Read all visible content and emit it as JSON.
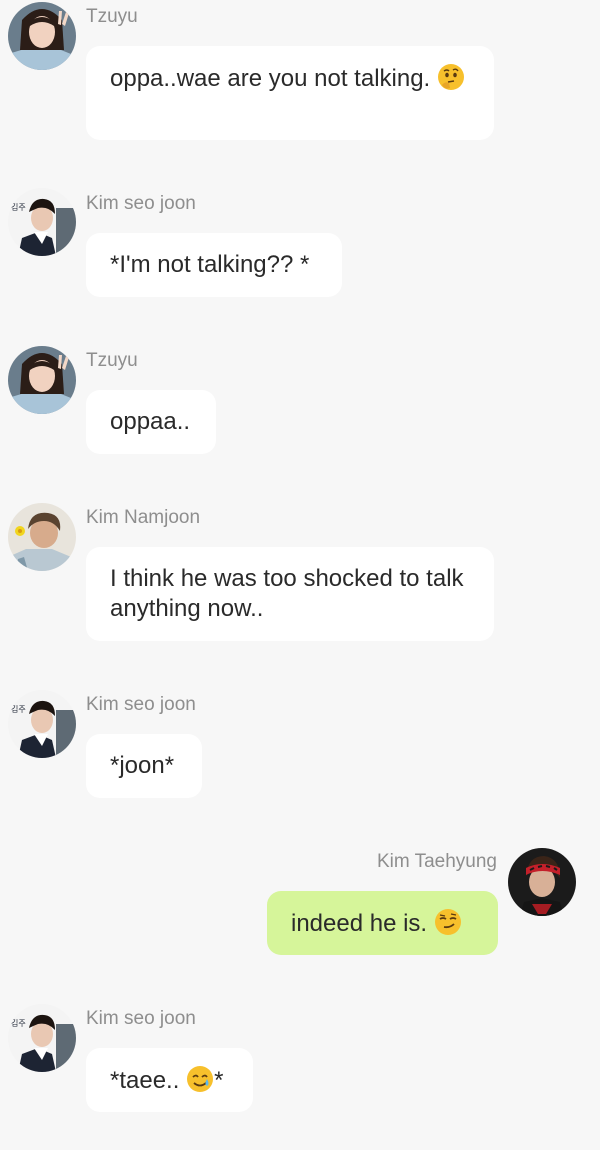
{
  "messages": [
    {
      "sender": "Tzuyu",
      "text": "oppa..wae are you not talking. ",
      "emoji": "thinking-face"
    },
    {
      "sender": "Kim seo joon",
      "text": "*I'm not talking?? *"
    },
    {
      "sender": "Tzuyu",
      "text": "oppaa.."
    },
    {
      "sender": "Kim Namjoon",
      "text": "I think he was too shocked to talk anything now.."
    },
    {
      "sender": "Kim seo joon",
      "text": "*joon*"
    },
    {
      "sender": "Kim Taehyung",
      "text": "indeed he is.  ",
      "emoji": "smirking-face",
      "outgoing": true
    },
    {
      "sender": "Kim seo joon",
      "text": "*taee.. ",
      "emoji": "smiling-face-with-tear",
      "text_after": "*"
    }
  ],
  "colors": {
    "background": "#f7f7f7",
    "incoming_bubble": "#ffffff",
    "outgoing_bubble": "#d6f59a",
    "sender_name": "#8e8e8e",
    "message_text": "#2a2a2a"
  }
}
